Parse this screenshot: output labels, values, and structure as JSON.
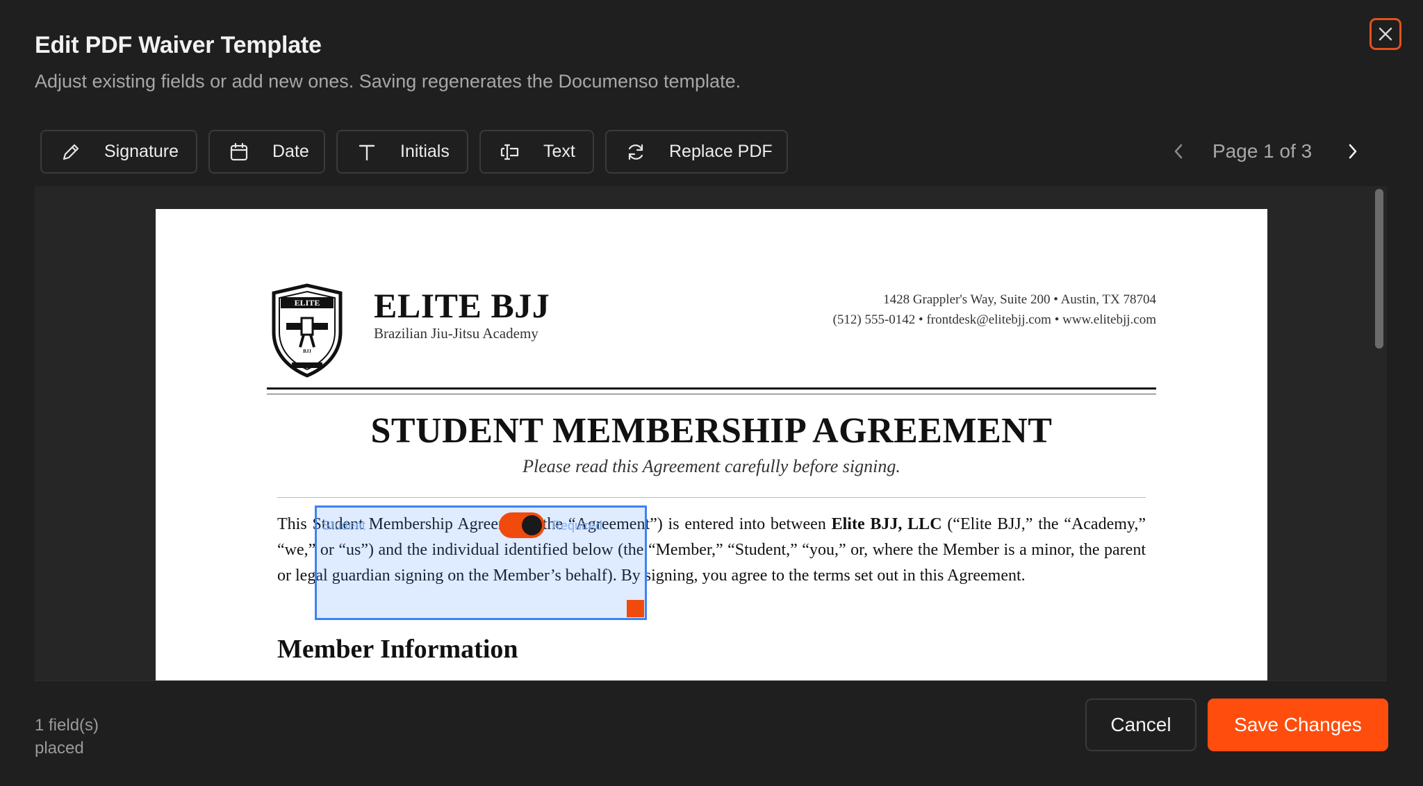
{
  "dialog": {
    "title": "Edit PDF Waiver Template",
    "subtitle": "Adjust existing fields or add new ones. Saving regenerates the Documenso template."
  },
  "toolbar": {
    "signature_label": "Signature",
    "date_label": "Date",
    "initials_label": "Initials",
    "text_label": "Text",
    "replace_label": "Replace PDF"
  },
  "pager": {
    "label": "Page 1 of 3"
  },
  "document": {
    "brand": "ELITE BJJ",
    "brand_sub": "Brazilian Jiu-Jitsu Academy",
    "logo_text": "ELITE",
    "logo_small": "BJJ",
    "address_line1": "1428 Grappler's Way, Suite 200  •  Austin, TX 78704",
    "address_line2": "(512) 555-0142  •  frontdesk@elitebjj.com  •  www.elitebjj.com",
    "title": "STUDENT MEMBERSHIP AGREEMENT",
    "tagline": "Please read this Agreement carefully before signing.",
    "para_start": "This Student Membership Agreement (the “Agreement”) is entered into between ",
    "para_bold": "Elite BJJ, LLC",
    "para_end": " (“Elite BJJ,” the “Academy,” “we,” or “us”) and the individual identified below (the “Member,” “Student,” “you,” or, where the Member is a minor, the parent or legal guardian signing on the Member’s behalf). By signing, you agree to the terms set out in this Agreement.",
    "section_heading": "Member Information"
  },
  "field": {
    "label_left": "Student",
    "label_right": "Required"
  },
  "footer": {
    "count": "1 field(s) placed",
    "cancel_label": "Cancel",
    "save_label": "Save Changes"
  },
  "colors": {
    "accent": "#ff4d0d",
    "field_border": "#3b82f6",
    "background": "#1f1f1f"
  }
}
